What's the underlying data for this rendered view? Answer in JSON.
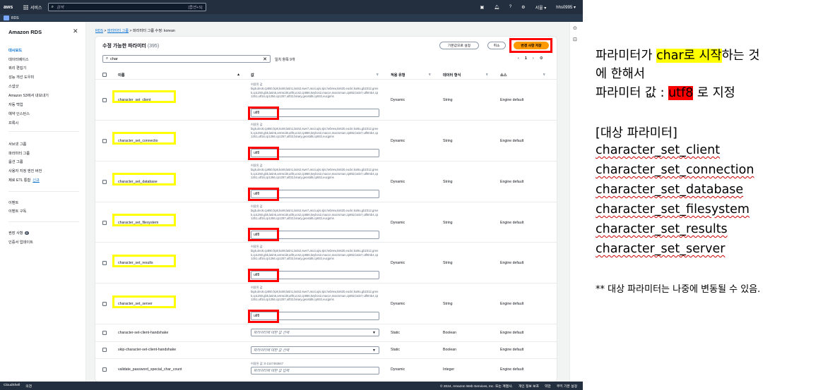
{
  "topnav": {
    "logo": "aws",
    "services": "서비스",
    "search_placeholder": "검색",
    "search_kbd": "[옵션+S]",
    "region": "서울 ▾",
    "account": "hhs0995 ▾"
  },
  "subnav": {
    "label": "RDS"
  },
  "sidebar": {
    "title": "Amazon RDS",
    "items": [
      "대시보드",
      "데이터베이스",
      "쿼리 편집기",
      "성능 개선 도우미",
      "스냅샷",
      "Amazon S3에서 내보내기",
      "자동 백업",
      "예약 인스턴스",
      "프록시",
      "서브넷 그룹",
      "파라미터 그룹",
      "옵션 그룹",
      "사용자 지정 엔진 버전",
      "제로 ETL 통합",
      "이벤트",
      "이벤트 구독",
      "권장 사항",
      "인증서 업데이트"
    ],
    "new_label": "신규",
    "badge": "0"
  },
  "breadcrumb": [
    "RDS",
    "파라미터 그룹",
    "파라미터 그룹 수정: korean"
  ],
  "panel": {
    "title": "수정 가능한 파라미터",
    "count": "(395)",
    "buttons": {
      "reset": "기본값으로 설정",
      "cancel": "취소",
      "save": "변경 사항 저장"
    },
    "filter_value": "char",
    "match_count": "일치 항목 9개",
    "page": "1",
    "headers": {
      "name": "이름",
      "value": "값",
      "apply": "적용 유형",
      "datatype": "데이터 형식",
      "source": "소스"
    }
  },
  "rows": [
    {
      "name": "character_set_client",
      "allowed_label": "허용된 값",
      "allowed": "big5,dec8,cp850,hp8,koi8r,latin1,latin2,swe7,ascii,ujis,sjis,hebrew,tis620,euckr,koi8u,gb2312,greek,cp1250,gbk,latin5,armscii8,utf8,ucs2,cp866,keybcs2,macce,macroman,cp852,latin7,utf8mb4,cp1251,utf16,cp1256,cp1257,utf32,binary,geostd8,cp932,eucjpms",
      "value": "utf8",
      "apply": "Dynamic",
      "datatype": "String",
      "source": "Engine default"
    },
    {
      "name": "character_set_connectio",
      "allowed_label": "허용된 값",
      "allowed": "big5,dec8,cp850,hp8,koi8r,latin1,latin2,swe7,ascii,ujis,sjis,hebrew,tis620,euckr,koi8u,gb2312,greek,cp1250,gbk,latin5,armscii8,utf8,ucs2,cp866,keybcs2,macce,macroman,cp852,latin7,utf8mb4,cp1251,utf16,cp1256,cp1257,utf32,binary,geostd8,cp932,eucjpms",
      "value": "utf8",
      "apply": "Dynamic",
      "datatype": "String",
      "source": "Engine default"
    },
    {
      "name": "character_set_database",
      "allowed_label": "허용된 값",
      "allowed": "big5,dec8,cp850,hp8,koi8r,latin1,latin2,swe7,ascii,ujis,sjis,hebrew,tis620,euckr,koi8u,gb2312,greek,cp1250,gbk,latin5,armscii8,utf8,ucs2,cp866,keybcs2,macce,macroman,cp852,latin7,utf8mb4,cp1251,utf16,cp1256,cp1257,utf32,binary,geostd8,cp932,eucjpms",
      "value": "utf8",
      "apply": "Dynamic",
      "datatype": "String",
      "source": "Engine default"
    },
    {
      "name": "character_set_filesystem",
      "allowed_label": "허용된 값",
      "allowed": "big5,dec8,cp850,hp8,koi8r,latin1,latin2,swe7,ascii,ujis,sjis,hebrew,tis620,euckr,koi8u,gb2312,greek,cp1250,gbk,latin5,armscii8,utf8,ucs2,cp866,keybcs2,macce,macroman,cp852,latin7,utf8mb4,cp1251,utf16,cp1256,cp1257,utf32,binary,geostd8,cp932,eucjpms",
      "value": "utf8",
      "apply": "Dynamic",
      "datatype": "String",
      "source": "Engine default"
    },
    {
      "name": "character_set_results",
      "allowed_label": "허용된 값",
      "allowed": "big5,dec8,cp850,hp8,koi8r,latin1,latin2,swe7,ascii,ujis,sjis,hebrew,tis620,euckr,koi8u,gb2312,greek,cp1250,gbk,latin5,armscii8,utf8,ucs2,cp866,keybcs2,macce,macroman,cp852,latin7,utf8mb4,cp1251,utf16,cp1256,cp1257,utf32,binary,geostd8,cp932,eucjpms",
      "value": "utf8",
      "apply": "Dynamic",
      "datatype": "String",
      "source": "Engine default"
    },
    {
      "name": "character_set_server",
      "allowed_label": "허용된 값",
      "allowed": "big5,dec8,cp850,hp8,koi8r,latin1,latin2,swe7,ascii,ujis,sjis,hebrew,tis620,euckr,koi8u,gb2312,greek,cp1250,gbk,latin5,armscii8,utf8,ucs2,cp866,keybcs2,macce,macroman,cp852,latin7,utf8mb4,cp1251,utf16,cp1256,cp1257,utf32,binary,geostd8,cp932,eucjpms",
      "value": "utf8",
      "apply": "Dynamic",
      "datatype": "String",
      "source": "Engine default"
    },
    {
      "name": "character-set-client-handshake",
      "select_placeholder": "파라미터에 대한 값 선택",
      "apply": "Static",
      "datatype": "Boolean",
      "source": "Engine default"
    },
    {
      "name": "skip-character-set-client-handshake",
      "select_placeholder": "파라미터에 대한 값 선택",
      "apply": "Static",
      "datatype": "Boolean",
      "source": "Engine default"
    },
    {
      "name": "validate_password_special_char_count",
      "allowed_label": "허용된 값: 0-2147483647",
      "input_placeholder": "파라미터에 대한 값 입력",
      "apply": "Dynamic",
      "datatype": "Integer",
      "source": "Engine default"
    }
  ],
  "footer": {
    "cloudshell": "CloudShell",
    "feedback": "의견",
    "copyright": "© 2024, Amazon Web Services, Inc. 또는 계열사.",
    "privacy": "개인 정보 보호",
    "terms": "약관",
    "cookies": "쿠키 기본 설정"
  },
  "annotation": {
    "line1_pre": "파라미터가 ",
    "line1_hl": "char로 시작",
    "line1_post": "하는 것",
    "line2": "에 한해서",
    "line3_pre": "파라미터 값 : ",
    "line3_hl": "utf8",
    "line3_post": " 로 지정",
    "target_title": "[대상 파라미터]",
    "targets": [
      "character_set_client",
      "character_set_connection",
      "character_set_database",
      "character_set_filesystem",
      "character_set_results",
      "character_set_server"
    ],
    "footnote": "** 대상 파라미터는 나중에 변동될 수 있음."
  },
  "colors": {
    "aws_nav": "#232f3e",
    "primary": "#ff9900",
    "link": "#0972d3",
    "highlight_yellow": "#ffff00",
    "highlight_red": "#ff0000"
  }
}
